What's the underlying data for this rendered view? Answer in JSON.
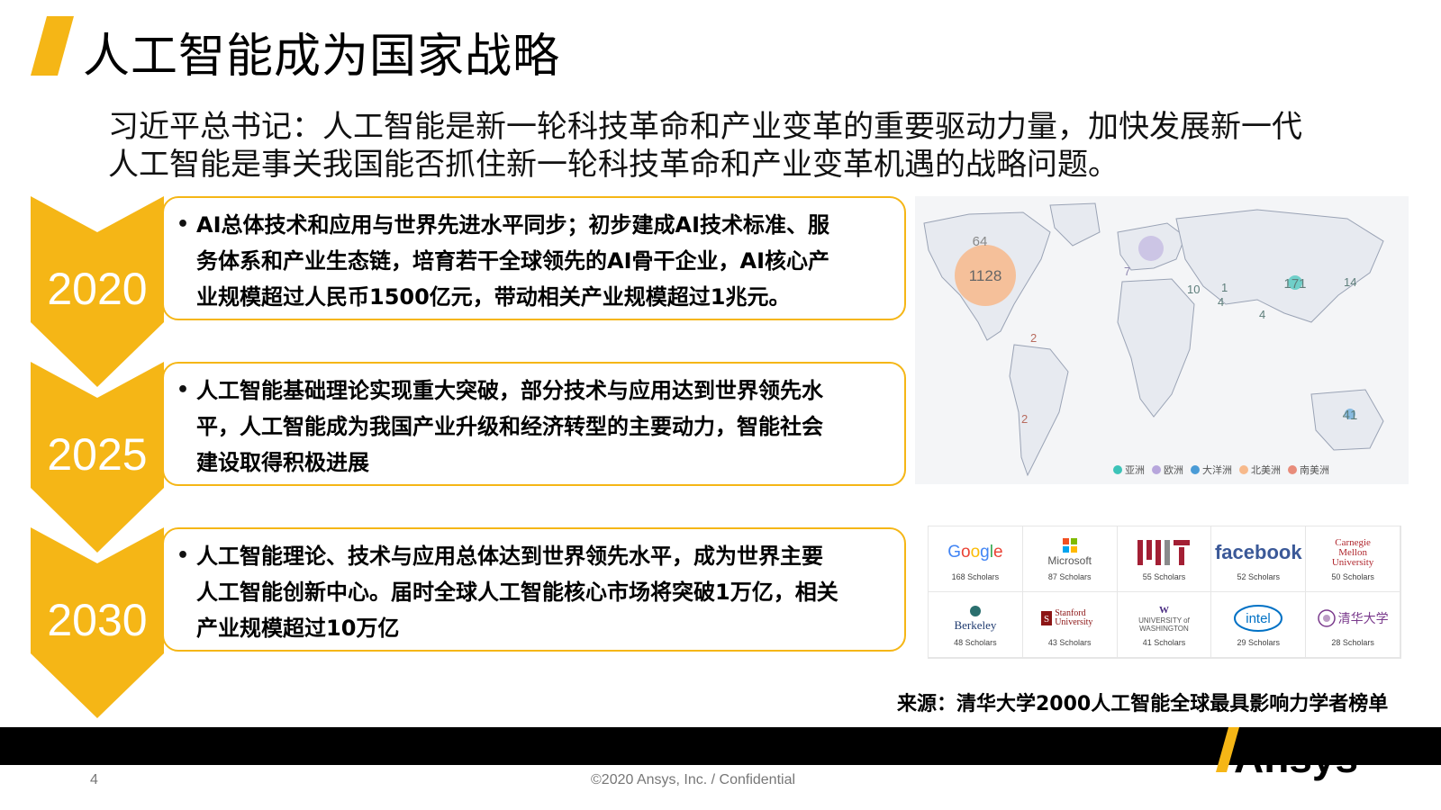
{
  "slide": {
    "title": "人工智能成为国家战略",
    "quote": [
      "习近平总书记：人工智能是新一轮科技革命和产业变革的重要驱动力量，加快发展新一代",
      "人工智能是事关我国能否抓住新一轮科技革命和产业变革机遇的战略问题。"
    ]
  },
  "timeline": [
    {
      "year": "2020",
      "lines": [
        "AI总体技术和应用与世界先进水平同步；初步建成AI技术标准、服",
        "务体系和产业生态链，培育若干全球领先的AI骨干企业，AI核心产",
        "业规模超过人民币1500亿元，带动相关产业规模超过1兆元。"
      ]
    },
    {
      "year": "2025",
      "lines": [
        "人工智能基础理论实现重大突破，部分技术与应用达到世界领先水",
        "平，人工智能成为我国产业升级和经济转型的主要动力，智能社会",
        "建设取得积极进展"
      ]
    },
    {
      "year": "2030",
      "lines": [
        "人工智能理论、技术与应用总体达到世界领先水平，成为世界主要",
        "人工智能创新中心。届时全球人工智能核心市场将突破1万亿，相关",
        "产业规模超过10万亿"
      ]
    }
  ],
  "map": {
    "labels": [
      "64",
      "1128",
      "171",
      "41",
      "4",
      "4",
      "1",
      "10",
      "7",
      "2",
      "2",
      "14"
    ],
    "legend": [
      {
        "label": "亚洲",
        "color": "#3cc3b8"
      },
      {
        "label": "欧洲",
        "color": "#b7a6dc"
      },
      {
        "label": "大洋洲",
        "color": "#4a9bd6"
      },
      {
        "label": "北美洲",
        "color": "#f7b98b"
      },
      {
        "label": "南美洲",
        "color": "#e88c7b"
      }
    ]
  },
  "orgs": [
    {
      "name": "Google",
      "count": "168 Scholars"
    },
    {
      "name": "Microsoft",
      "count": "87 Scholars"
    },
    {
      "name": "MIT",
      "count": "55 Scholars"
    },
    {
      "name": "facebook",
      "count": "52 Scholars"
    },
    {
      "name": "Carnegie Mellon University",
      "count": "50 Scholars"
    },
    {
      "name": "Berkeley",
      "count": "48 Scholars"
    },
    {
      "name": "Stanford University",
      "count": "43 Scholars"
    },
    {
      "name": "UNIVERSITY of WASHINGTON",
      "count": "41 Scholars"
    },
    {
      "name": "intel",
      "count": "29 Scholars"
    },
    {
      "name": "清华大学",
      "count": "28 Scholars"
    }
  ],
  "source": "来源：清华大学2000人工智能全球最具影响力学者榜单",
  "footer": {
    "page": "4",
    "copyright": "©2020 Ansys, Inc. / Confidential",
    "brand": "Ansys"
  },
  "colors": {
    "accent": "#f5b616",
    "black": "#000000"
  }
}
